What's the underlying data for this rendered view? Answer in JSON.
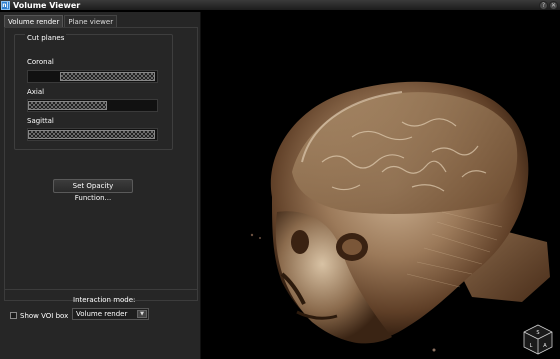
{
  "window": {
    "title": "Volume Viewer",
    "icon_glyph": "n|",
    "icon_name": "app-icon",
    "buttons": [
      {
        "name": "help-icon",
        "glyph": "?"
      },
      {
        "name": "close-icon",
        "glyph": "✕"
      }
    ]
  },
  "tabs": [
    {
      "label": "Volume render",
      "active": true
    },
    {
      "label": "Plane viewer",
      "active": false
    }
  ],
  "cut_planes": {
    "title": "Cut planes",
    "sliders": [
      {
        "label": "Coronal",
        "range": [
          0.25,
          1.0
        ]
      },
      {
        "label": "Axial",
        "range": [
          0.0,
          0.62
        ]
      },
      {
        "label": "Sagittal",
        "range": [
          0.0,
          1.0
        ]
      }
    ]
  },
  "opacity_button": "Set Opacity Function...",
  "show_voi": {
    "label": "Show VOI box",
    "checked": false
  },
  "interaction": {
    "label": "Interaction mode:",
    "value": "Volume render"
  },
  "orientation_cube": {
    "faces": [
      "S",
      "L",
      "A"
    ]
  },
  "colors": {
    "accent": "#2f7fd0",
    "panel": "#262626",
    "render_highlight": "#d9c3a5",
    "render_shadow": "#5a3a22"
  }
}
